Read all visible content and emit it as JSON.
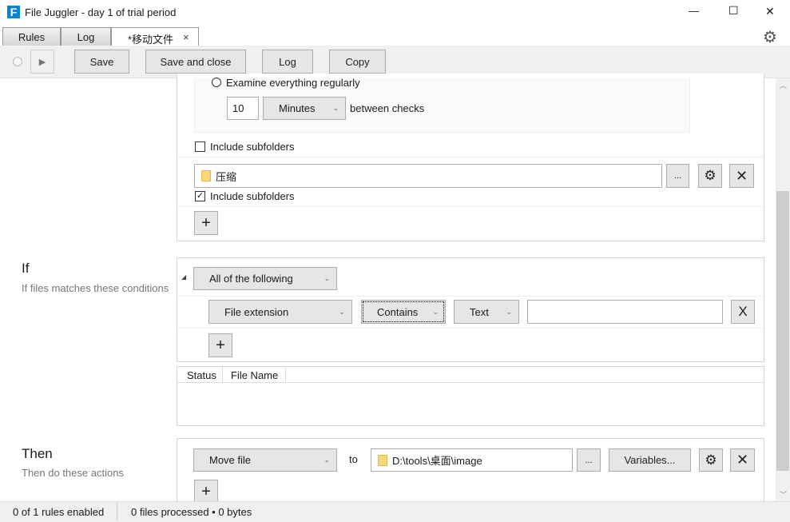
{
  "window": {
    "title": "File Juggler - day 1 of trial period",
    "logo": "F",
    "minimize": "—",
    "maximize": "☐",
    "close": "✕"
  },
  "tabs": [
    {
      "label": "Rules"
    },
    {
      "label": "Log"
    },
    {
      "label": "*移动文件",
      "close": "×"
    }
  ],
  "toolbar": {
    "save": "Save",
    "save_close": "Save and close",
    "log": "Log",
    "copy": "Copy"
  },
  "when": {
    "examine_label": "Examine everything regularly",
    "interval": "10",
    "unit": "Minutes",
    "between": "between checks",
    "include1": "Include subfolders",
    "folder": "压缩",
    "folder_more": "...",
    "include2": "Include subfolders",
    "include2_checked": true,
    "add": "+"
  },
  "if": {
    "title": "If",
    "subtitle": "If files matches these conditions",
    "group": "All of the following",
    "condition": {
      "field": "File extension",
      "operator": "Contains",
      "type": "Text",
      "value": ""
    },
    "add": "+",
    "remove": "X",
    "table_headers": [
      "Status",
      "File Name"
    ]
  },
  "then": {
    "title": "Then",
    "subtitle": "Then do these actions",
    "action": "Move file",
    "to": "to",
    "path": "D:\\tools\\桌面\\image",
    "more": "...",
    "variables": "Variables...",
    "remove": "X",
    "add": "+"
  },
  "status": {
    "rules": "0 of 1 rules enabled",
    "files": "0 files processed • 0 bytes"
  },
  "colors": {
    "accent": "#0078d7"
  }
}
